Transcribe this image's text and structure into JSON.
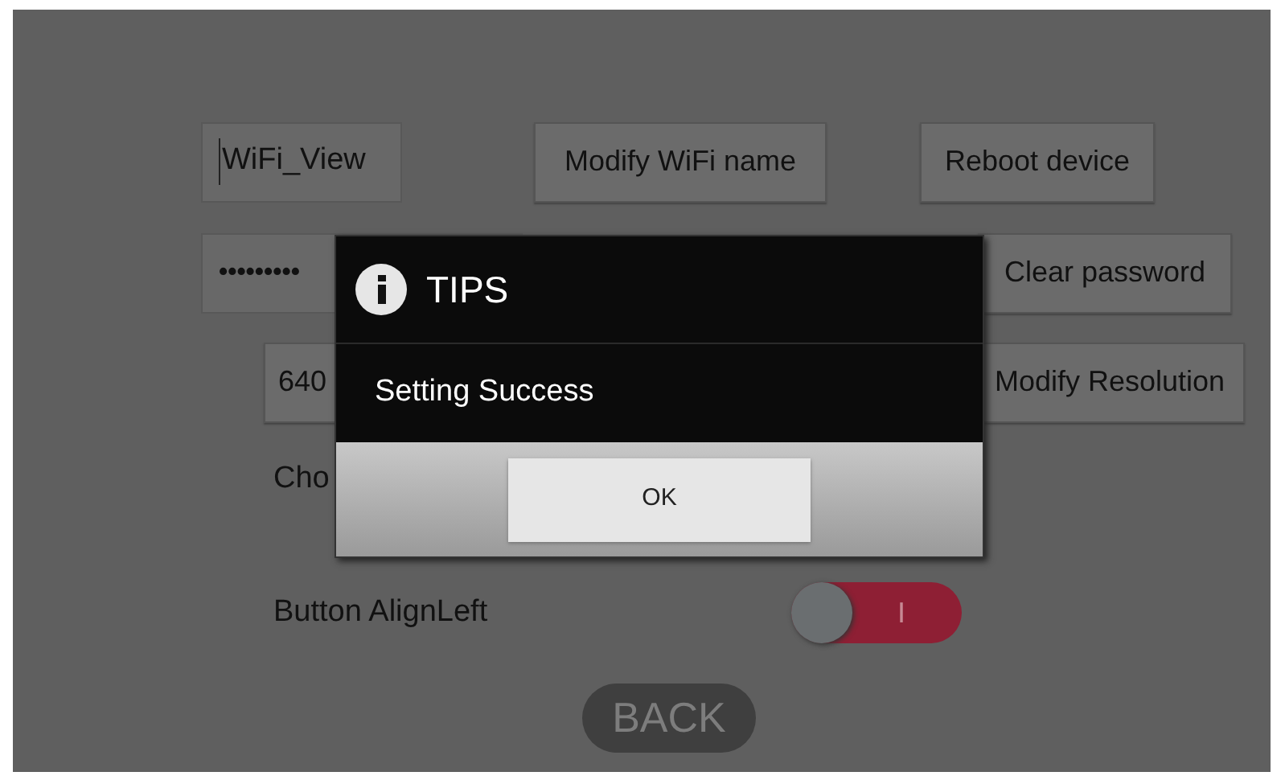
{
  "wifi_name_field": {
    "value": "WiFi_View"
  },
  "row1_buttons": [
    "Modify WiFi name",
    "Reboot device"
  ],
  "password_field": {
    "value": "•••••••••"
  },
  "clear_password_button": "Clear password",
  "resolution_button": "640",
  "modify_resolution_button": "Modify Resolution",
  "choose_label": "Cho",
  "align_setting": {
    "label": "Button AlignLeft",
    "on": false,
    "switch_mark": "I"
  },
  "back_button": "BACK",
  "dialog": {
    "title": "TIPS",
    "message": "Setting Success",
    "button": "OK"
  }
}
